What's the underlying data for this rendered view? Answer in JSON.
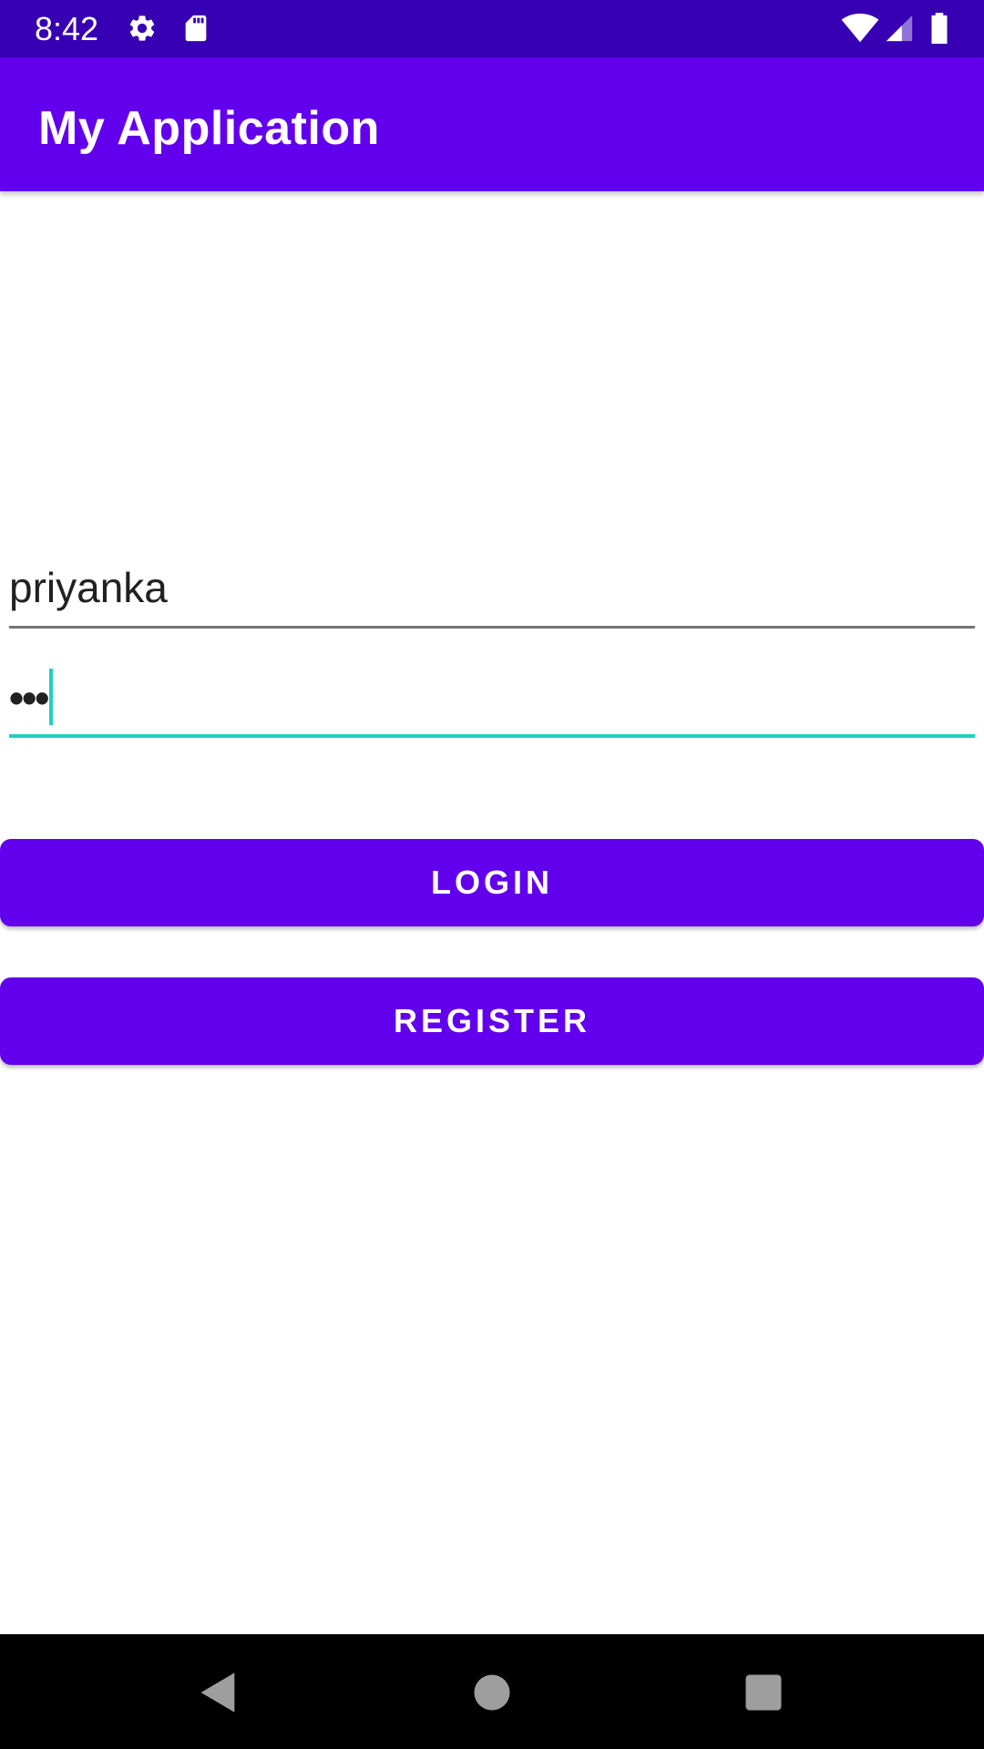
{
  "status_bar": {
    "time": "8:42",
    "icons": [
      "gear-icon",
      "sd-card-icon",
      "wifi-icon",
      "signal-icon",
      "battery-icon"
    ],
    "background": "#3700b3"
  },
  "app_bar": {
    "title": "My Application",
    "background": "#6200ee"
  },
  "form": {
    "username": {
      "value": "priyanka",
      "placeholder": ""
    },
    "password": {
      "value": "•••",
      "placeholder": "",
      "focused": true,
      "accent": "#21d0c0"
    }
  },
  "buttons": {
    "login_label": "LOGIN",
    "register_label": "REGISTER",
    "color": "#6200ee"
  },
  "nav_bar": {
    "icons": [
      "back-icon",
      "home-icon",
      "recents-icon"
    ]
  }
}
